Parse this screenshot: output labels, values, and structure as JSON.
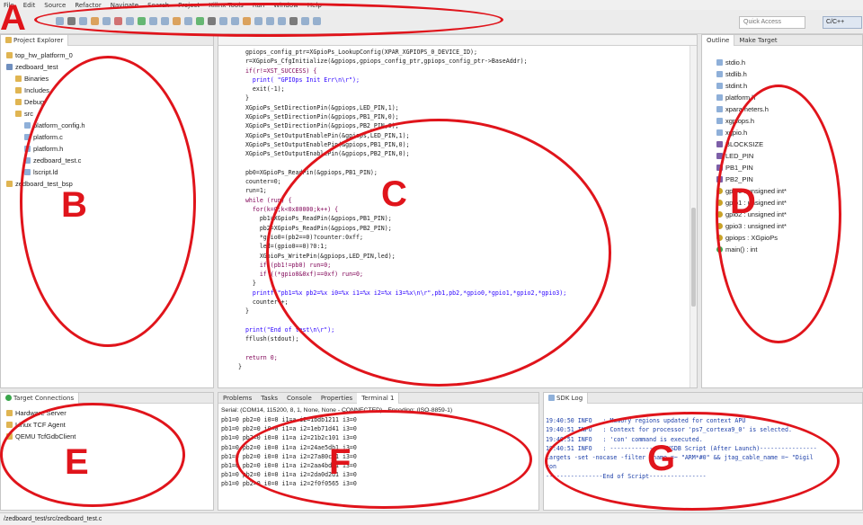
{
  "menu": [
    "File",
    "Edit",
    "Source",
    "Refactor",
    "Navigate",
    "Search",
    "Project",
    "Xilinx Tools",
    "Run",
    "Window",
    "Help"
  ],
  "toolbar": {
    "quick_access": "Quick Access",
    "perspective": "C/C++"
  },
  "project_explorer": {
    "title": "Project Explorer",
    "items": [
      {
        "label": "top_hw_platform_0",
        "level": 0,
        "icon": "folder-icon"
      },
      {
        "label": "zedboard_test",
        "level": 0,
        "icon": "project-icon"
      },
      {
        "label": "Binaries",
        "level": 1,
        "icon": "folder-icon"
      },
      {
        "label": "Includes",
        "level": 1,
        "icon": "folder-icon"
      },
      {
        "label": "Debug",
        "level": 1,
        "icon": "folder-icon"
      },
      {
        "label": "src",
        "level": 1,
        "icon": "folder-icon"
      },
      {
        "label": "platform_config.h",
        "level": 2,
        "icon": "file-icon"
      },
      {
        "label": "platform.c",
        "level": 2,
        "icon": "file-icon"
      },
      {
        "label": "platform.h",
        "level": 2,
        "icon": "file-icon"
      },
      {
        "label": "zedboard_test.c",
        "level": 2,
        "icon": "file-icon"
      },
      {
        "label": "lscript.ld",
        "level": 2,
        "icon": "file-icon"
      },
      {
        "label": "zedboard_test_bsp",
        "level": 0,
        "icon": "folder-icon"
      }
    ]
  },
  "editor": {
    "lines": [
      "  gpiops_config_ptr=XGpioPs_LookupConfig(XPAR_XGPIOPS_0_DEVICE_ID);",
      "  r=XGpioPs_CfgInitialize(&gpiops,gpiops_config_ptr,gpiops_config_ptr->BaseAddr);",
      "  if(r!=XST_SUCCESS) {",
      "    print( \"GPIOps Init Err\\n\\r\");",
      "    exit(-1);",
      "  }",
      "  XGpioPs_SetDirectionPin(&gpiops,LED_PIN,1);",
      "  XGpioPs_SetDirectionPin(&gpiops,PB1_PIN,0);",
      "  XGpioPs_SetDirectionPin(&gpiops,PB2_PIN,0);",
      "  XGpioPs_SetOutputEnablePin(&gpiops,LED_PIN,1);",
      "  XGpioPs_SetOutputEnablePin(&gpiops,PB1_PIN,0);",
      "  XGpioPs_SetOutputEnablePin(&gpiops,PB2_PIN,0);",
      "",
      "  pb0=XGpioPs_ReadPin(&gpiops,PB1_PIN);",
      "  counter=0;",
      "  run=1;",
      "  while (run) {",
      "    for(k=0;k<0x80000;k++) {",
      "      pb1=XGpioPs_ReadPin(&gpiops,PB1_PIN);",
      "      pb2=XGpioPs_ReadPin(&gpiops,PB2_PIN);",
      "      *gpio0=(pb2==0)?counter:0xff;",
      "      led=(gpio0==0)?0:1;",
      "      XGpioPs_WritePin(&gpiops,LED_PIN,led);",
      "      if (pb1!=pb0) run=0;",
      "      if ((*gpio0&0xf)==0xf) run=0;",
      "    }",
      "    printf(\"pb1=%x pb2=%x i0=%x i1=%x i2=%x i3=%x\\n\\r\",pb1,pb2,*gpio0,*gpio1,*gpio2,*gpio3);",
      "    counter++;",
      "  }",
      "",
      "  print(\"End of test\\n\\r\");",
      "  fflush(stdout);",
      "",
      "  return 0;",
      "}"
    ]
  },
  "outline": {
    "tabs": [
      "Outline",
      "Make Target"
    ],
    "items": [
      {
        "label": "stdio.h",
        "icon": "include-icon"
      },
      {
        "label": "stdlib.h",
        "icon": "include-icon"
      },
      {
        "label": "stdint.h",
        "icon": "include-icon"
      },
      {
        "label": "platform.h",
        "icon": "include-icon"
      },
      {
        "label": "xparameters.h",
        "icon": "include-icon"
      },
      {
        "label": "xgpiops.h",
        "icon": "include-icon"
      },
      {
        "label": "xgpio.h",
        "icon": "include-icon"
      },
      {
        "label": "BLOCKSIZE",
        "icon": "define-icon"
      },
      {
        "label": "LED_PIN",
        "icon": "define-icon"
      },
      {
        "label": "PB1_PIN",
        "icon": "define-icon"
      },
      {
        "label": "PB2_PIN",
        "icon": "define-icon"
      },
      {
        "label": "gpio0 : unsigned int*",
        "icon": "variable-icon"
      },
      {
        "label": "gpio1 : unsigned int*",
        "icon": "variable-icon"
      },
      {
        "label": "gpio2 : unsigned int*",
        "icon": "variable-icon"
      },
      {
        "label": "gpio3 : unsigned int*",
        "icon": "variable-icon"
      },
      {
        "label": "gpiops : XGpioPs",
        "icon": "variable-icon"
      },
      {
        "label": "main() : int",
        "icon": "function-icon"
      }
    ]
  },
  "target_connections": {
    "title": "Target Connections",
    "items": [
      "Hardware Server",
      "Linux TCF Agent",
      "QEMU TcfGdbClient"
    ]
  },
  "terminal": {
    "tabs": [
      "Problems",
      "Tasks",
      "Console",
      "Properties",
      "Terminal 1"
    ],
    "serial": "Serial: (COM14, 115200, 8, 1, None, None - CONNECTED) - Encoding: (ISO-8859-1)",
    "lines": [
      "pb1=0 pb2=0 i0=0 i1=a i2=1bdb1211 i3=0",
      "pb1=0 pb2=0 i0=0 i1=a i2=1eb71d41 i3=0",
      "pb1=0 pb2=0 i0=0 i1=a i2=21b2c101 i3=0",
      "pb1=0 pb2=0 i0=0 i1=a i2=24ae5db1 i3=0",
      "pb1=0 pb2=0 i0=0 i1=a i2=27a80c01 i3=0",
      "pb1=0 pb2=0 i0=0 i1=a i2=2aa4bd01 i3=0",
      "pb1=0 pb2=0 i0=0 i1=a i2=2da0d2d1 i3=0",
      "pb1=0 pb2=0 i0=0 i1=a i2=2f0f0565 i3=0"
    ]
  },
  "sdk_log": {
    "title": "SDK Log",
    "lines": [
      "19:40:50 INFO   : Memory regions updated for context APU",
      "19:40:51 INFO   : Context for processor 'ps7_cortexa9_0' is selected.",
      "19:40:51 INFO   : 'con' command is executed.",
      "19:40:51 INFO   : ----------------XSDB Script (After Launch)----------------",
      "targets -set -nocase -filter {name =~ \"ARM*#0\" && jtag_cable_name =~ \"Digil",
      "con",
      "----------------End of Script----------------"
    ]
  },
  "statusbar": {
    "path": "/zedboard_test/src/zedboard_test.c"
  },
  "annotations": [
    "A",
    "B",
    "C",
    "D",
    "E",
    "F",
    "G"
  ],
  "colors": {
    "annotation": "#e0141b",
    "keyword": "#7f0055",
    "string": "#2a00ff",
    "log": "#1b3ea8"
  }
}
